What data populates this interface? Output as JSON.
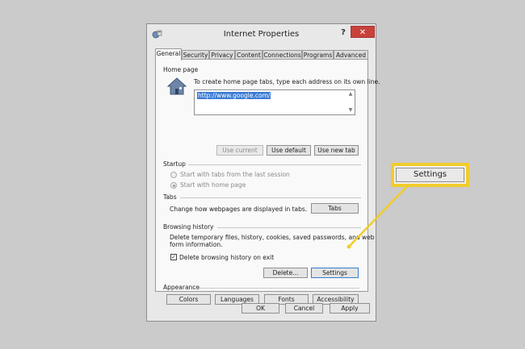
{
  "window": {
    "title": "Internet Properties",
    "help": "?",
    "close": "✕"
  },
  "tabs": [
    "General",
    "Security",
    "Privacy",
    "Content",
    "Connections",
    "Programs",
    "Advanced"
  ],
  "home_page": {
    "heading": "Home page",
    "description": "To create home page tabs, type each address on its own line.",
    "url": "http://www.google.com/",
    "buttons": {
      "use_current": "Use current",
      "use_default": "Use default",
      "use_new_tab": "Use new tab"
    }
  },
  "startup": {
    "heading": "Startup",
    "option_last_session": "Start with tabs from the last session",
    "option_home_page": "Start with home page"
  },
  "tabs_section": {
    "heading": "Tabs",
    "description": "Change how webpages are displayed in tabs.",
    "button": "Tabs"
  },
  "browsing_history": {
    "heading": "Browsing history",
    "description_line1": "Delete temporary files, history, cookies, saved passwords, and web",
    "description_line2": "form information.",
    "checkbox_label": "Delete browsing history on exit",
    "delete_button": "Delete...",
    "settings_button": "Settings"
  },
  "appearance": {
    "heading": "Appearance",
    "colors": "Colors",
    "languages": "Languages",
    "fonts": "Fonts",
    "accessibility": "Accessibility"
  },
  "footer": {
    "ok": "OK",
    "cancel": "Cancel",
    "apply": "Apply"
  },
  "callout": {
    "label": "Settings",
    "color": "#f2cc2c"
  }
}
